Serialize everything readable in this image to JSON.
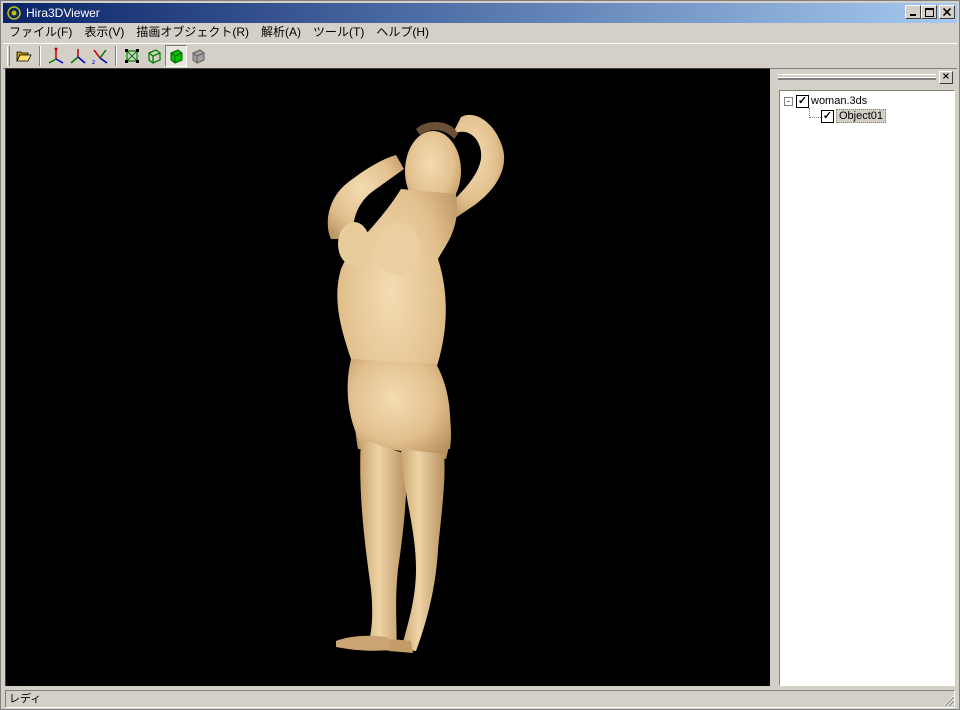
{
  "window": {
    "title": "Hira3DViewer",
    "minimize_label": "_",
    "maximize_label": "□",
    "close_label": "×"
  },
  "menu": [
    {
      "label": "ファイル(F)"
    },
    {
      "label": "表示(V)"
    },
    {
      "label": "描画オブジェクト(R)"
    },
    {
      "label": "解析(A)"
    },
    {
      "label": "ツール(T)"
    },
    {
      "label": "ヘルプ(H)"
    }
  ],
  "toolbar": {
    "tools": [
      "open-folder-icon",
      "axis-xy-icon",
      "axis-yz-icon",
      "axis-zx-icon",
      "wireframe-icon",
      "flat-shade-icon",
      "solid-shade-icon",
      "normal-icon"
    ]
  },
  "tree": {
    "root": {
      "label": "woman.3ds",
      "checked": true,
      "expander": "-",
      "check_mark": "✓"
    },
    "child": {
      "label": "Object01",
      "checked": true,
      "check_mark": "✓"
    }
  },
  "panel": {
    "close_label": "×"
  },
  "status": {
    "text": "レディ"
  },
  "colors": {
    "title_start": "#0a246a",
    "title_end": "#a6caf0",
    "viewport_bg": "#000000",
    "model": "#e8c99a"
  }
}
